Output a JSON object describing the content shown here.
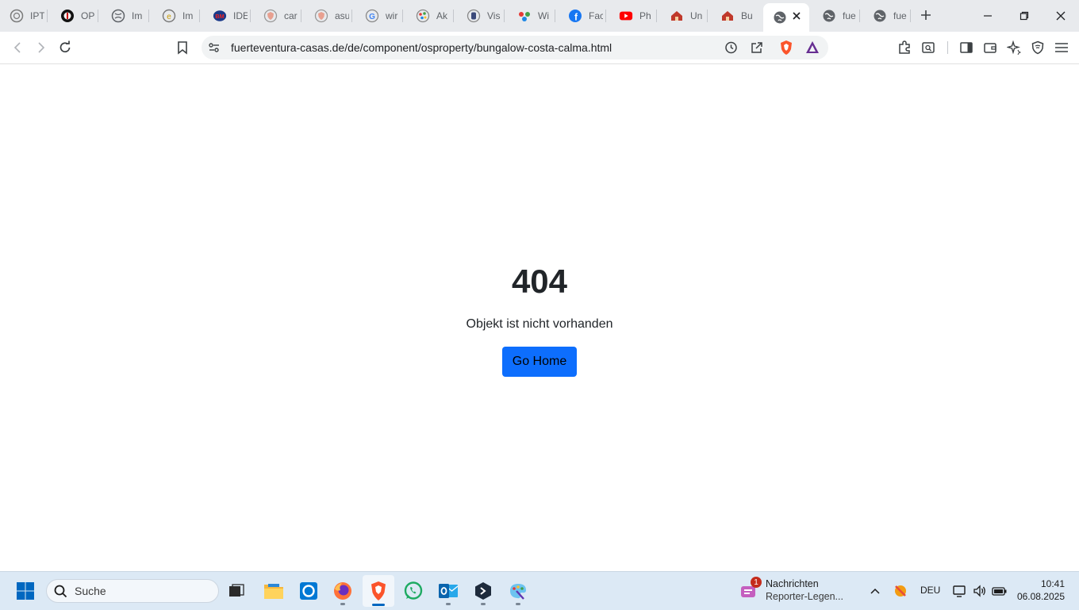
{
  "tabs": [
    {
      "label": "IPT",
      "icon": "globe-outline-icon"
    },
    {
      "label": "OP",
      "icon": "badge-icon"
    },
    {
      "label": "Im",
      "icon": "globe-icon"
    },
    {
      "label": "Im",
      "icon": "e-circle-icon"
    },
    {
      "label": "IDE",
      "icon": "bm-icon"
    },
    {
      "label": "car",
      "icon": "shield-icon"
    },
    {
      "label": "asu",
      "icon": "shield-icon"
    },
    {
      "label": "wir",
      "icon": "google-icon"
    },
    {
      "label": "Ak",
      "icon": "dots-circle-icon"
    },
    {
      "label": "Vis",
      "icon": "crest-icon"
    },
    {
      "label": "Wi",
      "icon": "tri-dot-icon"
    },
    {
      "label": "Fac",
      "icon": "facebook-icon"
    },
    {
      "label": "Ph",
      "icon": "youtube-icon"
    },
    {
      "label": "Un",
      "icon": "house-icon"
    },
    {
      "label": "Bu",
      "icon": "house-icon"
    },
    {
      "label": "",
      "icon": "globe-icon",
      "active": true
    },
    {
      "label": "fue",
      "icon": "globe-icon"
    },
    {
      "label": "fue",
      "icon": "globe-icon"
    }
  ],
  "toolbar": {
    "url": "fuerteventura-casas.de/de/component/osproperty/bungalow-costa-calma.html"
  },
  "page": {
    "code": "404",
    "message": "Objekt ist nicht vorhanden",
    "button_label": "Go Home",
    "button_color": "#0d6efd"
  },
  "taskbar": {
    "search_placeholder": "Suche",
    "news_title": "Nachrichten",
    "news_subtitle": "Reporter-Legen...",
    "news_badge": "1",
    "language": "DEU",
    "time": "10:41",
    "date": "06.08.2025",
    "apps": [
      "task-view-icon",
      "file-explorer-icon",
      "cortana-icon",
      "firefox-icon",
      "brave-icon",
      "whatsapp-icon",
      "outlook-icon",
      "app-icon",
      "paint-icon"
    ]
  }
}
